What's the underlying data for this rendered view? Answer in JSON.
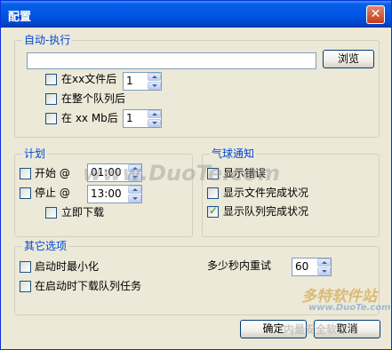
{
  "window": {
    "title": "配置",
    "close_glyph": "✕"
  },
  "auto_exec": {
    "legend": "自动-执行",
    "path_value": "",
    "browse_label": "浏览",
    "after_files_label": "在xx文件后",
    "after_files_value": "1",
    "after_queue_label": "在整个队列后",
    "after_mb_label": "在 xx Mb后",
    "after_mb_value": "1"
  },
  "schedule": {
    "legend": "计划",
    "start_label": "开始 @",
    "start_time": "01:00",
    "stop_label": "停止 @",
    "stop_time": "13:00",
    "download_now_label": "立即下载"
  },
  "balloon": {
    "legend": "气球通知",
    "show_errors_label": "显示错误",
    "show_file_done_label": "显示文件完成状况",
    "show_queue_done_label": "显示队列完成状况",
    "show_errors_checked": false,
    "show_file_done_checked": false,
    "show_queue_done_checked": true
  },
  "other": {
    "legend": "其它选项",
    "minimize_label": "启动时最小化",
    "download_queue_label": "在启动时下载队列任务",
    "retry_label": "多少秒内重试",
    "retry_value": "60"
  },
  "buttons": {
    "ok_label": "确定",
    "cancel_label": "取消"
  },
  "watermarks": {
    "center": "www.DuoTe.com",
    "logo_text": "多特软件站",
    "logo_url": "www.DuoTe.com",
    "bottom": "内最安全软件站"
  }
}
